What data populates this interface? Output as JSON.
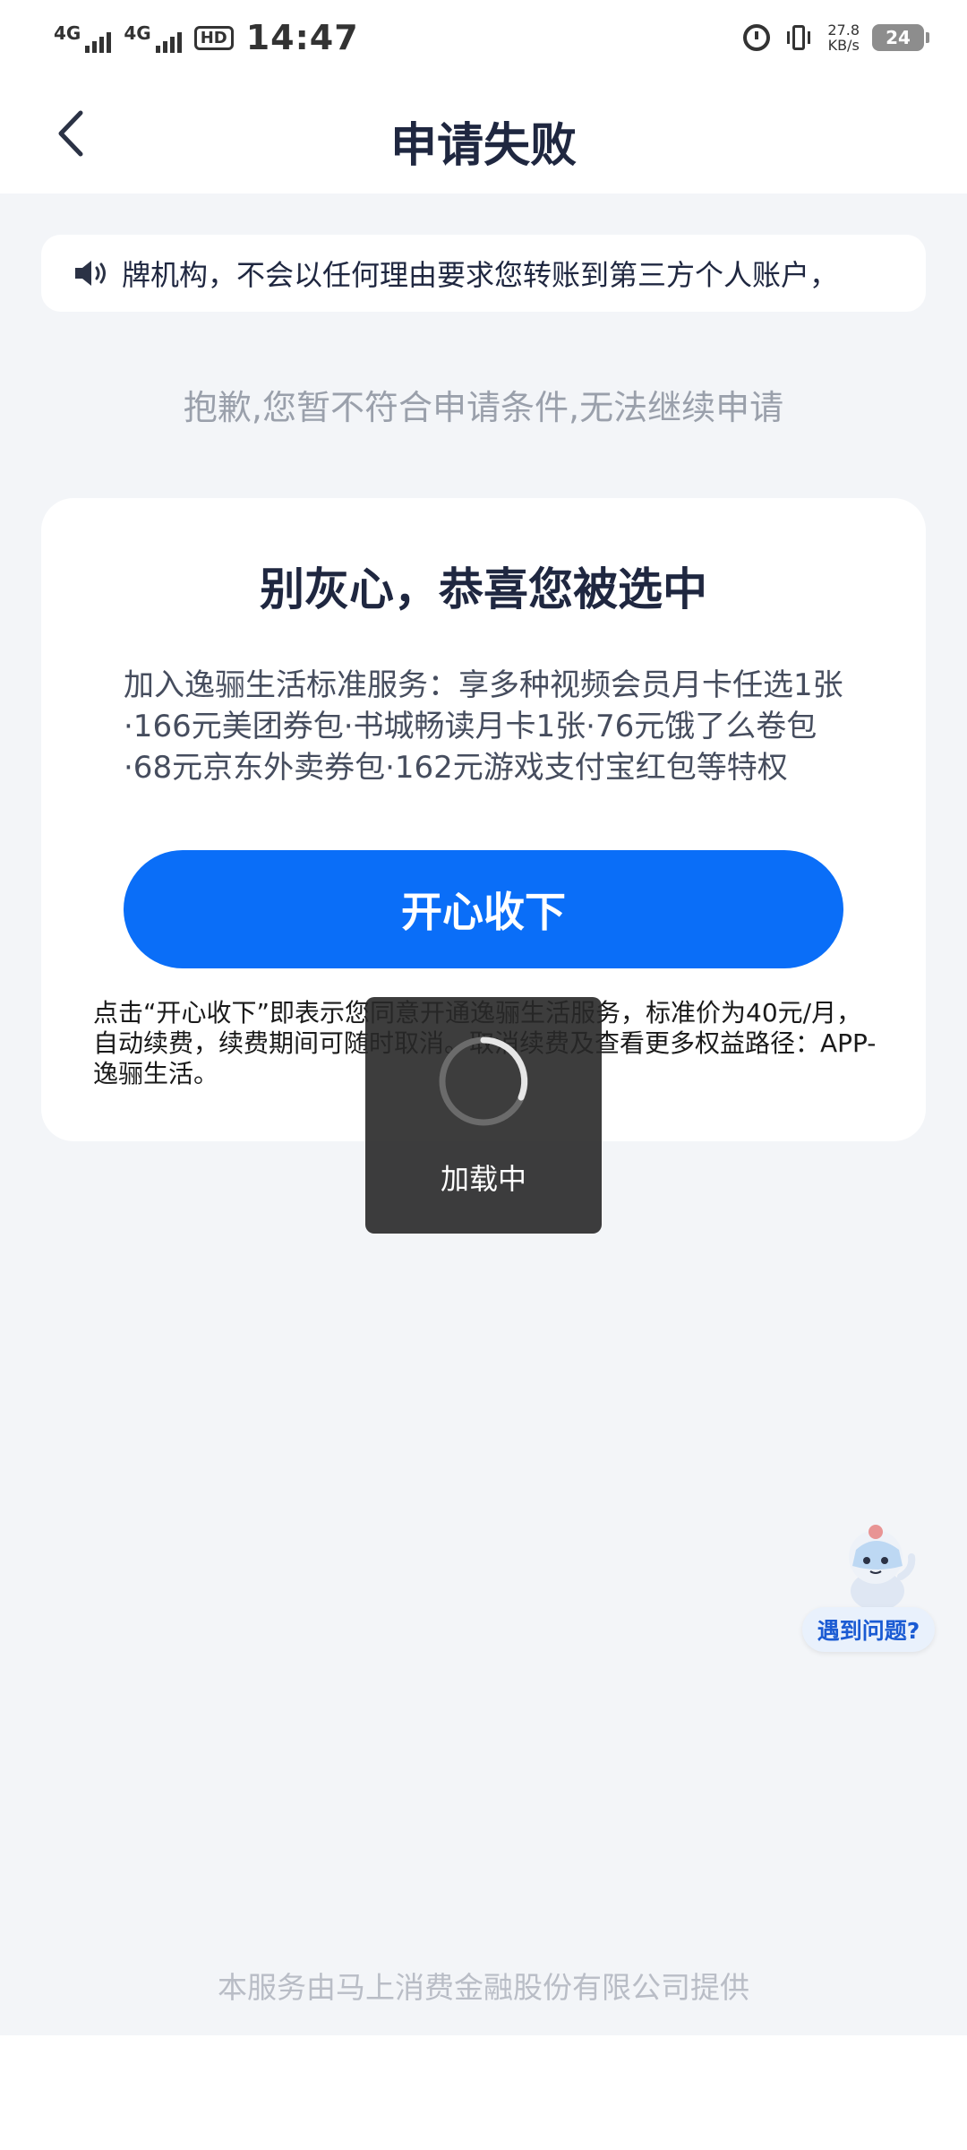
{
  "status_bar": {
    "network1": "4G",
    "network2": "4G",
    "hd": "HD",
    "time": "14:47",
    "speed_value": "27.8",
    "speed_unit": "KB/s",
    "battery": "24"
  },
  "nav": {
    "title": "申请失败"
  },
  "notice": {
    "text": "牌机构，不会以任何理由要求您转账到第三方个人账户，"
  },
  "sorry_message": "抱歉,您暂不符合申请条件,无法继续申请",
  "card": {
    "title": "别灰心，恭喜您被选中",
    "description": "加入逸骊生活标准服务：享多种视频会员月卡任选1张·166元美团券包·书城畅读月卡1张·76元饿了么卷包·68元京东外卖券包·162元游戏支付宝红包等特权",
    "button_label": "开心收下",
    "terms": "点击“开心收下”即表示您同意开通逸骊生活服务，标准价为40元/月，自动续费，续费期间可随时取消。取消续费及查看更多权益路径：APP-逸骊生活。"
  },
  "loading": {
    "text": "加载中"
  },
  "help": {
    "label": "遇到问题?"
  },
  "footer": {
    "text": "本服务由马上消费金融股份有限公司提供"
  },
  "colors": {
    "primary": "#0a6ef8",
    "background": "#f3f5f8",
    "title": "#1f2740",
    "muted": "#9aa0ab"
  }
}
